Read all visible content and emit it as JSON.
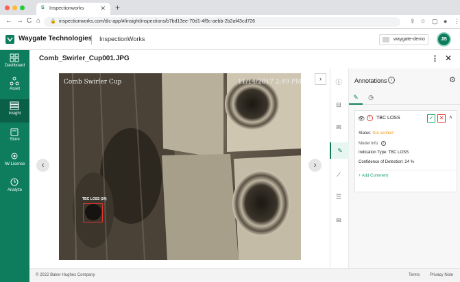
{
  "browser": {
    "tab_title": "Inspectionworks",
    "url": "inspectionworks.com/dic-app/#/insight/inspections/b7bd13ee-70d1-4f9c-aebb-2b2af43cd726"
  },
  "header": {
    "brand": "Waygate Technologies",
    "product": "InspectionWorks",
    "username": "waygate-demo",
    "avatar_initials": "JB"
  },
  "sidebar": {
    "items": [
      {
        "label": "Dashboard",
        "icon": "dashboard-icon"
      },
      {
        "label": "Asset",
        "icon": "asset-icon"
      },
      {
        "label": "Insight",
        "icon": "insight-icon"
      },
      {
        "label": "Store",
        "icon": "store-icon"
      },
      {
        "label": "IW License",
        "icon": "license-icon"
      },
      {
        "label": "Analyze",
        "icon": "analyze-icon"
      }
    ],
    "active": "Insight"
  },
  "main": {
    "title": "Comb_Swirler_Cup001.JPG",
    "image_caption": "Comb Swirler Cup",
    "image_timestamp": "11/14/2017  2:49 PM",
    "bbox_label": "TBC LOSS (24)"
  },
  "annotations": {
    "title": "Annotations",
    "item": {
      "name": "TBC LOSS",
      "status_label": "Status:",
      "status_value": "Not verified",
      "model_info_label": "Model Info",
      "indication_label": "Indication Type:",
      "indication_value": "TBC LOSS",
      "confidence_label": "Confidence of Detection:",
      "confidence_value": "24 %",
      "add_comment": "+ Add Comment"
    }
  },
  "footer": {
    "copyright": "© 2022 Baker Hughes Company",
    "terms": "Terms",
    "privacy": "Privacy Note"
  },
  "colors": {
    "brand_green": "#0e7d5e",
    "status_orange": "#f29a1c",
    "reject_red": "#e0342b"
  }
}
